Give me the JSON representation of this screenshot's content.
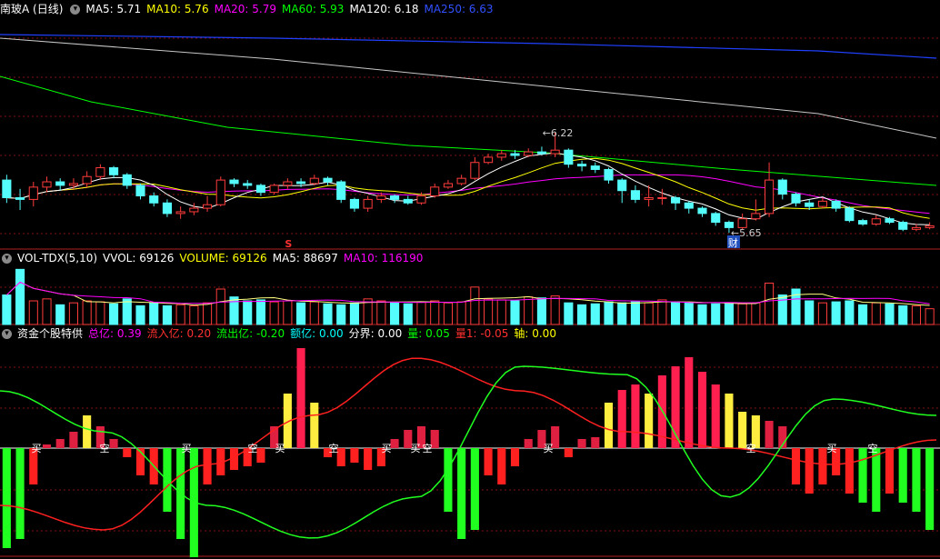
{
  "main_panel": {
    "title": "南玻A (日线)",
    "indicators": [
      {
        "label": "MA5: 5.71",
        "color": "#ffffff"
      },
      {
        "label": "MA10: 5.76",
        "color": "#ffff00"
      },
      {
        "label": "MA20: 5.79",
        "color": "#ff00ff"
      },
      {
        "label": "MA60: 5.93",
        "color": "#00ff00"
      },
      {
        "label": "MA120: 6.18",
        "color": "#ffffff"
      },
      {
        "label": "MA250: 6.63",
        "color": "#3050ff"
      }
    ],
    "high_label": "6.22",
    "low_label": "5.65",
    "marker_s": "S",
    "marker_cai": "财"
  },
  "vol_panel": {
    "title": "VOL-TDX(5,10)",
    "indicators": [
      {
        "label": "VVOL: 69126",
        "color": "#ffffff"
      },
      {
        "label": "VOLUME: 69126",
        "color": "#ffff00"
      },
      {
        "label": "MA5: 88697",
        "color": "#ffffff"
      },
      {
        "label": "MA10: 116190",
        "color": "#ff00ff"
      }
    ]
  },
  "fund_panel": {
    "title": "资金个股特供",
    "indicators": [
      {
        "label": "总亿: 0.39",
        "color": "#ff00ff"
      },
      {
        "label": "流入亿: 0.20",
        "color": "#ff3030"
      },
      {
        "label": "流出亿: -0.20",
        "color": "#00ff00"
      },
      {
        "label": "额亿: 0.00",
        "color": "#00ffff"
      },
      {
        "label": "分界: 0.00",
        "color": "#ffffff"
      },
      {
        "label": "量: 0.05",
        "color": "#00ff00"
      },
      {
        "label": "量1: -0.05",
        "color": "#ff3030"
      },
      {
        "label": "轴: 0.00",
        "color": "#ffff00"
      }
    ],
    "signals": [
      "买",
      "空",
      "买",
      "空",
      "买",
      "空",
      "买",
      "买",
      "空",
      "买",
      "空",
      "买",
      "空"
    ]
  },
  "colors": {
    "up": "#ff3c3c",
    "down": "#54fcfc",
    "grid": "#801010",
    "ma5": "#ffffff",
    "ma10": "#ffff00",
    "ma20": "#ff00ff",
    "ma60": "#00ff00",
    "ma120": "#c8c8c8",
    "ma250": "#2040ff"
  },
  "chart_data": {
    "type": "candlestick",
    "candles": [
      [
        5.95,
        5.85,
        5.98,
        5.82
      ],
      [
        5.85,
        5.84,
        5.9,
        5.78
      ],
      [
        5.84,
        5.91,
        5.94,
        5.8
      ],
      [
        5.91,
        5.94,
        5.97,
        5.88
      ],
      [
        5.94,
        5.92,
        5.96,
        5.89
      ],
      [
        5.92,
        5.93,
        5.96,
        5.9
      ],
      [
        5.93,
        5.97,
        6.0,
        5.91
      ],
      [
        5.97,
        6.02,
        6.04,
        5.95
      ],
      [
        6.02,
        5.98,
        6.03,
        5.96
      ],
      [
        5.98,
        5.92,
        5.99,
        5.9
      ],
      [
        5.92,
        5.86,
        5.93,
        5.84
      ],
      [
        5.86,
        5.82,
        5.88,
        5.8
      ],
      [
        5.82,
        5.76,
        5.84,
        5.74
      ],
      [
        5.76,
        5.77,
        5.8,
        5.73
      ],
      [
        5.77,
        5.79,
        5.82,
        5.75
      ],
      [
        5.79,
        5.81,
        5.86,
        5.77
      ],
      [
        5.81,
        5.95,
        5.97,
        5.8
      ],
      [
        5.95,
        5.93,
        5.96,
        5.91
      ],
      [
        5.93,
        5.92,
        5.95,
        5.9
      ],
      [
        5.92,
        5.88,
        5.93,
        5.86
      ],
      [
        5.88,
        5.92,
        5.93,
        5.87
      ],
      [
        5.92,
        5.94,
        5.96,
        5.9
      ],
      [
        5.94,
        5.93,
        5.96,
        5.91
      ],
      [
        5.93,
        5.96,
        5.98,
        5.92
      ],
      [
        5.96,
        5.94,
        5.97,
        5.92
      ],
      [
        5.94,
        5.84,
        5.95,
        5.82
      ],
      [
        5.84,
        5.79,
        5.85,
        5.77
      ],
      [
        5.79,
        5.84,
        5.86,
        5.77
      ],
      [
        5.84,
        5.86,
        5.88,
        5.82
      ],
      [
        5.86,
        5.84,
        5.87,
        5.82
      ],
      [
        5.84,
        5.82,
        5.86,
        5.81
      ],
      [
        5.82,
        5.86,
        5.88,
        5.81
      ],
      [
        5.86,
        5.91,
        5.93,
        5.85
      ],
      [
        5.91,
        5.93,
        5.95,
        5.9
      ],
      [
        5.93,
        5.96,
        5.98,
        5.92
      ],
      [
        5.96,
        6.05,
        6.08,
        5.95
      ],
      [
        6.05,
        6.08,
        6.1,
        6.04
      ],
      [
        6.08,
        6.1,
        6.12,
        6.06
      ],
      [
        6.1,
        6.09,
        6.12,
        6.07
      ],
      [
        6.09,
        6.11,
        6.13,
        6.08
      ],
      [
        6.11,
        6.1,
        6.14,
        6.09
      ],
      [
        6.1,
        6.12,
        6.22,
        6.08
      ],
      [
        6.12,
        6.04,
        6.13,
        6.02
      ],
      [
        6.04,
        6.03,
        6.06,
        6.0
      ],
      [
        6.03,
        6.01,
        6.05,
        5.99
      ],
      [
        6.01,
        5.95,
        6.02,
        5.93
      ],
      [
        5.95,
        5.89,
        5.96,
        5.82
      ],
      [
        5.89,
        5.84,
        5.92,
        5.82
      ],
      [
        5.84,
        5.85,
        5.92,
        5.8
      ],
      [
        5.85,
        5.85,
        5.9,
        5.81
      ],
      [
        5.85,
        5.82,
        5.86,
        5.78
      ],
      [
        5.82,
        5.79,
        5.83,
        5.76
      ],
      [
        5.79,
        5.76,
        5.8,
        5.74
      ],
      [
        5.76,
        5.71,
        5.77,
        5.69
      ],
      [
        5.71,
        5.68,
        5.72,
        5.65
      ],
      [
        5.68,
        5.73,
        5.76,
        5.67
      ],
      [
        5.73,
        5.76,
        5.84,
        5.72
      ],
      [
        5.76,
        5.95,
        6.05,
        5.74
      ],
      [
        5.95,
        5.87,
        5.96,
        5.84
      ],
      [
        5.87,
        5.82,
        5.88,
        5.8
      ],
      [
        5.82,
        5.8,
        5.84,
        5.78
      ],
      [
        5.8,
        5.83,
        5.85,
        5.79
      ],
      [
        5.83,
        5.79,
        5.84,
        5.77
      ],
      [
        5.79,
        5.72,
        5.8,
        5.71
      ],
      [
        5.72,
        5.7,
        5.73,
        5.69
      ],
      [
        5.7,
        5.73,
        5.75,
        5.69
      ],
      [
        5.73,
        5.71,
        5.74,
        5.7
      ],
      [
        5.71,
        5.67,
        5.72,
        5.66
      ],
      [
        5.67,
        5.68,
        5.7,
        5.66
      ],
      [
        5.68,
        5.69,
        5.71,
        5.67
      ]
    ],
    "volume": [
      150,
      280,
      120,
      130,
      100,
      110,
      120,
      115,
      105,
      130,
      95,
      110,
      95,
      100,
      95,
      110,
      180,
      140,
      120,
      125,
      115,
      120,
      110,
      115,
      105,
      100,
      110,
      130,
      120,
      110,
      105,
      115,
      120,
      110,
      115,
      190,
      130,
      125,
      120,
      140,
      135,
      145,
      110,
      100,
      105,
      115,
      110,
      115,
      110,
      125,
      115,
      110,
      100,
      105,
      110,
      105,
      110,
      210,
      150,
      180,
      120,
      110,
      115,
      120,
      100,
      110,
      105,
      95,
      95,
      80
    ],
    "fund": [
      -0.55,
      -0.5,
      -0.2,
      0.02,
      0.05,
      0.09,
      0.18,
      0.12,
      0.05,
      -0.05,
      -0.15,
      -0.2,
      -0.35,
      -0.5,
      -0.6,
      -0.2,
      -0.15,
      -0.12,
      -0.1,
      -0.08,
      0.12,
      0.3,
      0.55,
      0.25,
      -0.05,
      -0.1,
      -0.08,
      -0.12,
      -0.1,
      0.05,
      0.1,
      0.12,
      0.1,
      -0.35,
      -0.5,
      -0.45,
      -0.15,
      -0.2,
      -0.1,
      0.05,
      0.1,
      0.12,
      -0.05,
      0.05,
      0.06,
      0.25,
      0.32,
      0.35,
      0.3,
      0.4,
      0.45,
      0.5,
      0.42,
      0.35,
      0.3,
      0.2,
      0.18,
      0.15,
      0.12,
      -0.2,
      -0.25,
      -0.2,
      -0.15,
      -0.25,
      -0.3,
      -0.35,
      -0.25,
      -0.3,
      -0.35,
      -0.45
    ],
    "inflow_line": [
      -0.35,
      -0.5,
      -0.1,
      0.2,
      0.55,
      0.35,
      0.1,
      0.0,
      -0.1,
      0.05
    ],
    "outflow_line": [
      0.35,
      0.1,
      -0.35,
      -0.55,
      -0.3,
      0.5,
      0.45,
      -0.3,
      0.3,
      0.2
    ]
  }
}
